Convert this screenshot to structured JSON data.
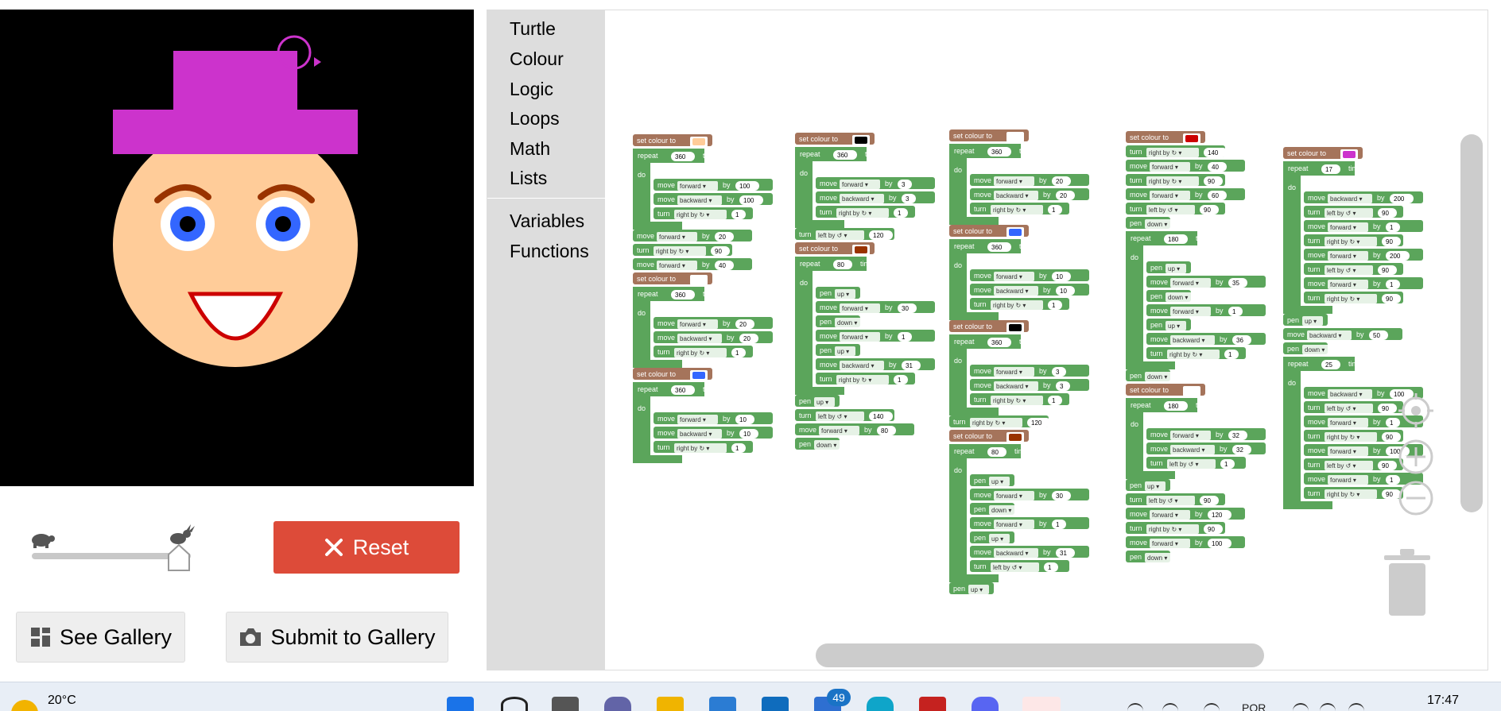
{
  "canvas": {
    "background": "#000000",
    "hat_color": "#cc33cc",
    "face_color": "#ffcc99",
    "eyebrow_color": "#993300",
    "eye_color": "#3366ff",
    "mouth_color": "#cc0000"
  },
  "controls": {
    "slow_icon": "turtle-icon",
    "fast_icon": "rabbit-icon",
    "speed_level": 1.0,
    "reset_label": "Reset",
    "see_gallery_label": "See Gallery",
    "submit_gallery_label": "Submit to Gallery"
  },
  "toolbox": {
    "categories": [
      "Turtle",
      "Colour",
      "Logic",
      "Loops",
      "Math",
      "Lists"
    ],
    "custom_categories": [
      "Variables",
      "Functions"
    ]
  },
  "blocks": {
    "set_colour": "set colour to",
    "repeat": "repeat",
    "times": "times",
    "do": "do",
    "move": "move",
    "turn": "turn",
    "by": "by",
    "pen": "pen",
    "forward": "forward",
    "backward": "backward",
    "right_by": "right by ↻",
    "left_by": "left by ↺",
    "up": "up",
    "down": "down"
  },
  "colors": {
    "motion": "#5ba55b",
    "loop": "#5ba55b",
    "colour": "#a5745b",
    "field": "#ffffff"
  },
  "taskbar": {
    "temperature": "20°C",
    "mail_badge": "49",
    "language": "POR",
    "time": "17:47"
  }
}
